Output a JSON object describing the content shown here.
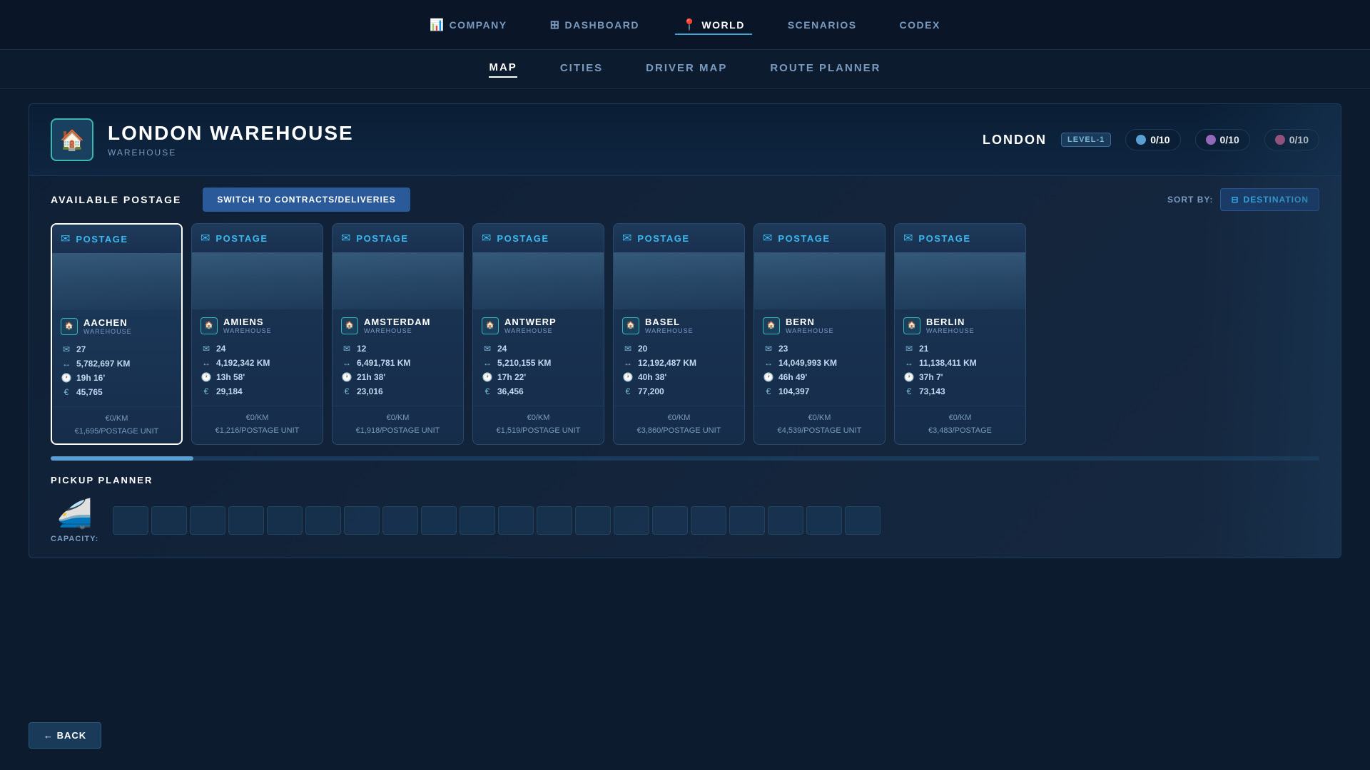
{
  "nav": {
    "items": [
      {
        "label": "COMPANY",
        "icon": "📊",
        "active": false
      },
      {
        "label": "DASHBOARD",
        "icon": "⊞",
        "active": false
      },
      {
        "label": "WORLD",
        "icon": "📍",
        "active": true
      },
      {
        "label": "SCENARIOS",
        "icon": "",
        "active": false
      },
      {
        "label": "CODEX",
        "icon": "",
        "active": false
      }
    ]
  },
  "subnav": {
    "items": [
      {
        "label": "MAP",
        "active": true
      },
      {
        "label": "CITIES",
        "active": false
      },
      {
        "label": "DRIVER MAP",
        "active": false
      },
      {
        "label": "ROUTE PLANNER",
        "active": false
      }
    ]
  },
  "warehouse": {
    "title": "LONDON WAREHOUSE",
    "subtitle": "WAREHOUSE",
    "city": "LONDON",
    "level": "LEVEL-1",
    "stats": [
      {
        "value": "0/10",
        "color": "blue"
      },
      {
        "value": "0/10",
        "color": "purple"
      },
      {
        "value": "0/10",
        "color": "pink"
      }
    ]
  },
  "postage": {
    "section_title": "AVAILABLE POSTAGE",
    "switch_btn": "SWITCH TO CONTRACTS/DELIVERIES",
    "sort_label": "SORT BY:",
    "sort_value": "DESTINATION",
    "cards": [
      {
        "header": "POSTAGE",
        "dest_name": "AACHEN",
        "dest_sub": "WAREHOUSE",
        "mail_count": "27",
        "distance": "5,782,697 KM",
        "time": "19h 16'",
        "value": "45,765",
        "rate_km": "€0/KM",
        "rate_unit": "€1,695/POSTAGE UNIT",
        "selected": true
      },
      {
        "header": "POSTAGE",
        "dest_name": "AMIENS",
        "dest_sub": "WAREHOUSE",
        "mail_count": "24",
        "distance": "4,192,342 KM",
        "time": "13h 58'",
        "value": "29,184",
        "rate_km": "€0/KM",
        "rate_unit": "€1,216/POSTAGE UNIT",
        "selected": false
      },
      {
        "header": "POSTAGE",
        "dest_name": "AMSTERDAM",
        "dest_sub": "WAREHOUSE",
        "mail_count": "12",
        "distance": "6,491,781 KM",
        "time": "21h 38'",
        "value": "23,016",
        "rate_km": "€0/KM",
        "rate_unit": "€1,918/POSTAGE UNIT",
        "selected": false
      },
      {
        "header": "POSTAGE",
        "dest_name": "ANTWERP",
        "dest_sub": "WAREHOUSE",
        "mail_count": "24",
        "distance": "5,210,155 KM",
        "time": "17h 22'",
        "value": "36,456",
        "rate_km": "€0/KM",
        "rate_unit": "€1,519/POSTAGE UNIT",
        "selected": false
      },
      {
        "header": "POSTAGE",
        "dest_name": "BASEL",
        "dest_sub": "WAREHOUSE",
        "mail_count": "20",
        "distance": "12,192,487 KM",
        "time": "40h 38'",
        "value": "77,200",
        "rate_km": "€0/KM",
        "rate_unit": "€3,860/POSTAGE UNIT",
        "selected": false
      },
      {
        "header": "POSTAGE",
        "dest_name": "BERN",
        "dest_sub": "WAREHOUSE",
        "mail_count": "23",
        "distance": "14,049,993 KM",
        "time": "46h 49'",
        "value": "104,397",
        "rate_km": "€0/KM",
        "rate_unit": "€4,539/POSTAGE UNIT",
        "selected": false
      },
      {
        "header": "POSTAGE",
        "dest_name": "BERLIN",
        "dest_sub": "WAREHOUSE",
        "mail_count": "21",
        "distance": "11,138,411 KM",
        "time": "37h 7'",
        "value": "73,143",
        "rate_km": "€0/KM",
        "rate_unit": "€3,483/POSTAGE",
        "selected": false
      }
    ]
  },
  "pickup": {
    "title": "PICKUP PLANNER",
    "capacity_label": "CAPACITY:"
  },
  "back_btn": "← BACK"
}
